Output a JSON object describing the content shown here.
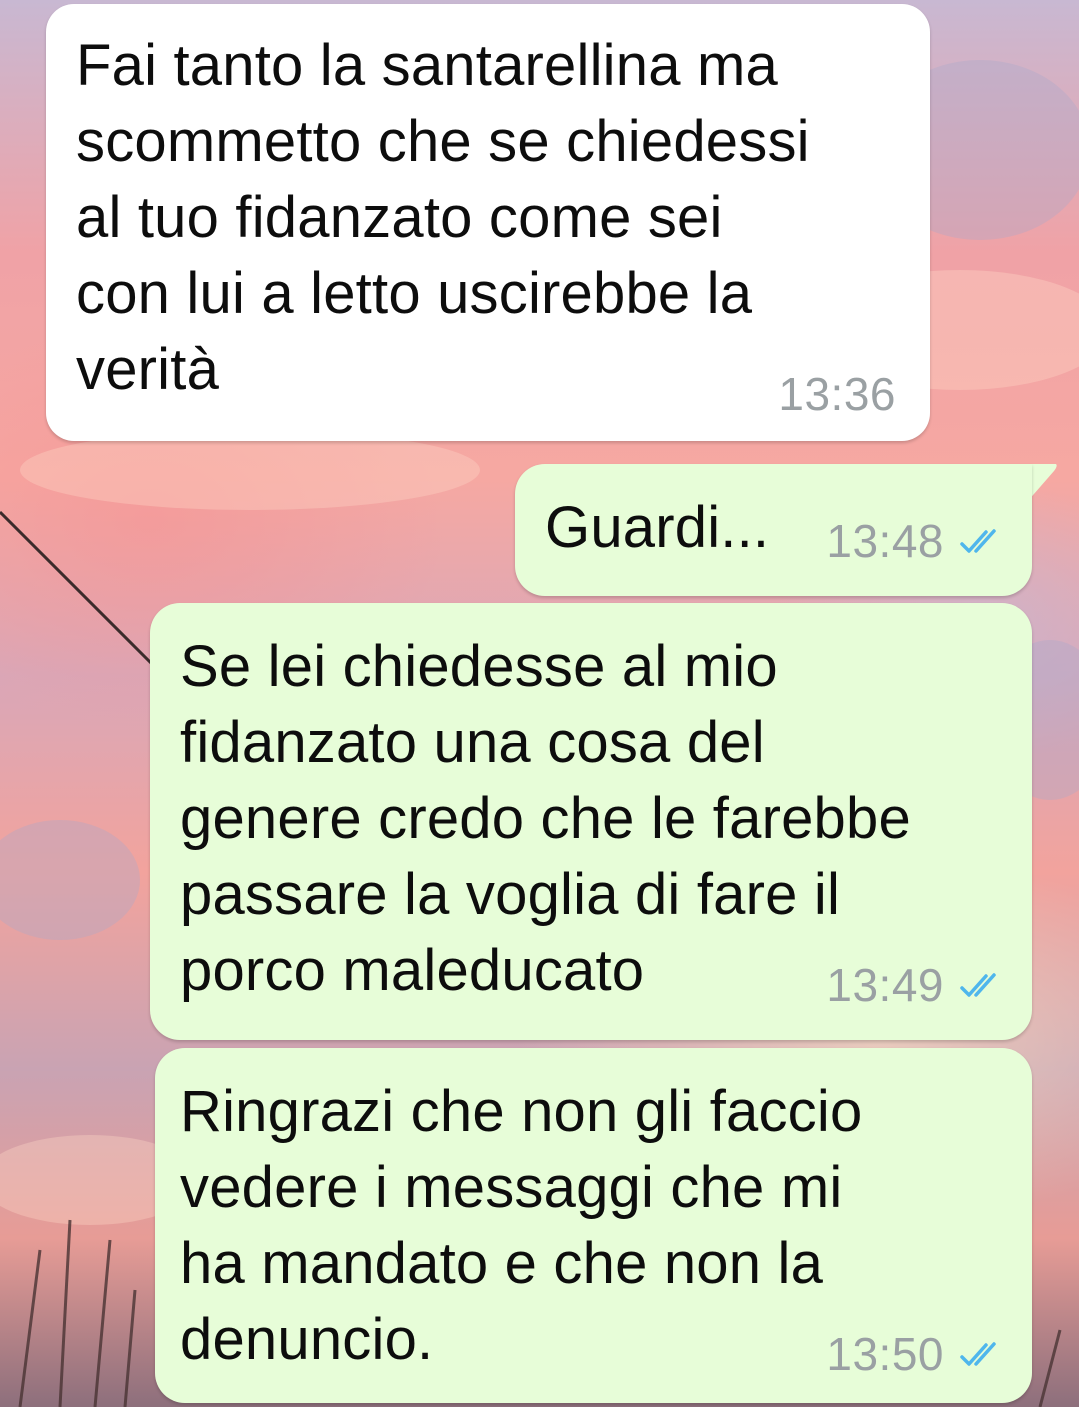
{
  "messages": [
    {
      "direction": "incoming",
      "text": "Fai tanto la santarellina ma\nscommetto che se chiedessi\nal tuo fidanzato come sei\ncon lui a letto uscirebbe la\nverità",
      "time": "13:36"
    },
    {
      "direction": "outgoing",
      "text": "Guardi...",
      "time": "13:48",
      "status_icon": "double-check-read-icon"
    },
    {
      "direction": "outgoing",
      "text": "Se lei chiedesse al mio\nfidanzato una cosa del\ngenere credo che le farebbe\npassare la voglia di fare il\nporco maleducato",
      "time": "13:49",
      "status_icon": "double-check-read-icon"
    },
    {
      "direction": "outgoing",
      "text": "Ringrazi che non gli faccio\nvedere i messaggi che mi\nha mandato e che non la\ndenuncio.",
      "time": "13:50",
      "status_icon": "double-check-read-icon"
    }
  ],
  "colors": {
    "incoming_bubble": "#ffffff",
    "outgoing_bubble": "#e7fdd8",
    "timestamp": "#9aa0a3",
    "read_ticks": "#4fb6ec"
  }
}
